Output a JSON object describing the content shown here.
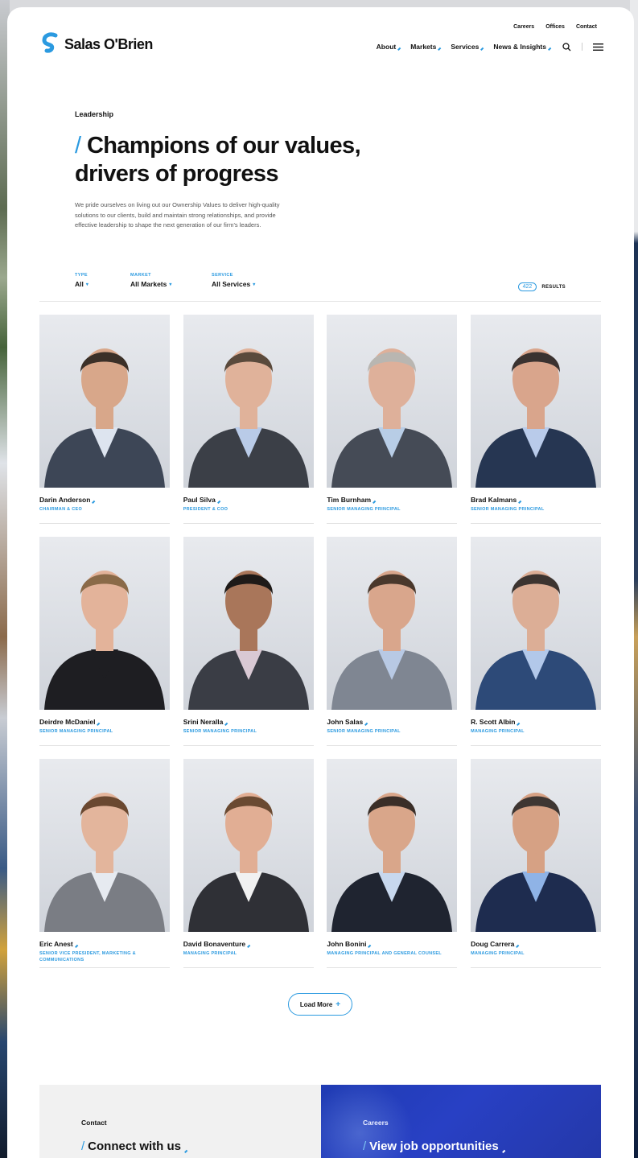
{
  "header": {
    "utility_links": [
      "Careers",
      "Offices",
      "Contact"
    ],
    "logo_text": "Salas O'Brien",
    "nav": [
      "About",
      "Markets",
      "Services",
      "News & Insights"
    ]
  },
  "hero": {
    "eyebrow": "Leadership",
    "title": "Champions of our values, drivers of progress",
    "description": "We pride ourselves on living out our Ownership Values to deliver high-quality solutions to our clients, build and maintain strong relationships, and provide effective leadership to shape the next generation of our firm's leaders."
  },
  "filters": [
    {
      "label": "TYPE",
      "value": "All"
    },
    {
      "label": "MARKET",
      "value": "All Markets"
    },
    {
      "label": "SERVICE",
      "value": "All Services"
    }
  ],
  "results": {
    "count": "422",
    "label": "RESULTS"
  },
  "people": [
    {
      "name": "Darin Anderson",
      "title": "Chairman & CEO",
      "hair": "#3b3028",
      "suit": "#3d4656",
      "shirt": "#dde4ef",
      "skin": "#d8a78a"
    },
    {
      "name": "Paul Silva",
      "title": "President & COO",
      "hair": "#5a4a3c",
      "suit": "#3b3f47",
      "shirt": "#b9cbe8",
      "skin": "#e0b29a"
    },
    {
      "name": "Tim Burnham",
      "title": "Senior Managing Principal",
      "hair": "#b9b6b1",
      "suit": "#454b56",
      "shirt": "#b8cde6",
      "skin": "#deb09a"
    },
    {
      "name": "Brad Kalmans",
      "title": "Senior Managing Principal",
      "hair": "#3a3230",
      "suit": "#263652",
      "shirt": "#b9cbea",
      "skin": "#d9a58c"
    },
    {
      "name": "Deirdre McDaniel",
      "title": "Senior Managing Principal",
      "hair": "#8a6a48",
      "suit": "#1e1e22",
      "shirt": "#1e1e22",
      "skin": "#e3b39a"
    },
    {
      "name": "Srini Neralla",
      "title": "Senior Managing Principal",
      "hair": "#1e1a18",
      "suit": "#3a3d45",
      "shirt": "#d9c9d4",
      "skin": "#a9765a"
    },
    {
      "name": "John Salas",
      "title": "Senior Managing Principal",
      "hair": "#4a382c",
      "suit": "#7f8692",
      "shirt": "#b8c9e4",
      "skin": "#d9a68c"
    },
    {
      "name": "R. Scott Albin",
      "title": "Managing Principal",
      "hair": "#3c3430",
      "suit": "#2d4a78",
      "shirt": "#b2c8ea",
      "skin": "#dcae96"
    },
    {
      "name": "Eric Anest",
      "title": "Senior Vice President, Marketing & Communications",
      "hair": "#6a4830",
      "suit": "#7a7d84",
      "shirt": "#e6eaf0",
      "skin": "#e3b59c"
    },
    {
      "name": "David Bonaventure",
      "title": "Managing Principal",
      "hair": "#6a4a32",
      "suit": "#2f3036",
      "shirt": "#f1f1f1",
      "skin": "#e1ae94"
    },
    {
      "name": "John Bonini",
      "title": "Managing Principal and General Counsel",
      "hair": "#3a2e28",
      "suit": "#1f2430",
      "shirt": "#c8d8ee",
      "skin": "#d9a68a"
    },
    {
      "name": "Doug Carrera",
      "title": "Managing Principal",
      "hair": "#3e3632",
      "suit": "#1e2c4f",
      "shirt": "#8fb3e6",
      "skin": "#d6a184"
    }
  ],
  "load_more": "Load More",
  "bottom": {
    "contact_label": "Contact",
    "contact_title": "Connect with us",
    "careers_label": "Careers",
    "careers_title": "View job opportunities"
  },
  "colors": {
    "accent": "#2b9ae0",
    "careers_panel": "#2840c4"
  }
}
